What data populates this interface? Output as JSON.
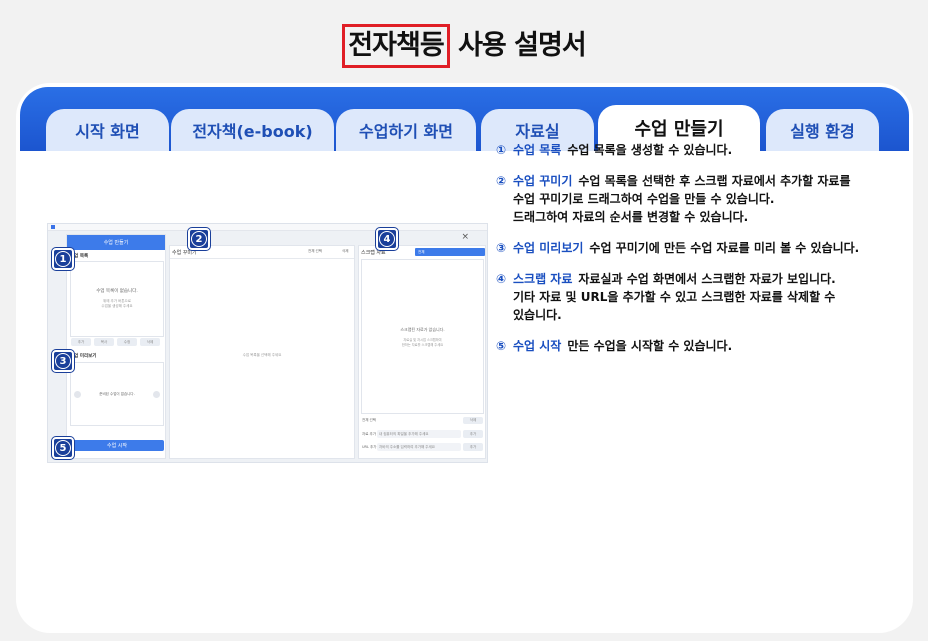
{
  "title": {
    "highlight": "전자책등",
    "rest": "사용 설명서"
  },
  "tabs": [
    {
      "label": "시작 화면"
    },
    {
      "label": "전자책(e-book)"
    },
    {
      "label": "수업하기 화면"
    },
    {
      "label": "자료실"
    },
    {
      "label": "수업 만들기"
    },
    {
      "label": "실행 환경"
    }
  ],
  "active_tab": "수업 만들기",
  "screenshot": {
    "window_title": "수업 만들기",
    "lesson_list": {
      "label": "수업 목록",
      "empty": "수업 목록이 없습니다.",
      "hint1": "위에 추가 버튼으로",
      "hint2": "수업을 생성해 주세요",
      "buttons": [
        "추가",
        "복사",
        "수정",
        "삭제"
      ]
    },
    "preview": {
      "label": "수업 미리보기",
      "empty": "준비된 수업이 없습니다."
    },
    "start_button": "수업 시작",
    "decorate": {
      "label": "수업 꾸미기",
      "select_all": "전체 선택",
      "delete": "삭제",
      "empty": "수업 목록을 선택해 주세요"
    },
    "scrap": {
      "label": "스크랩 자료",
      "filter": "전체",
      "empty": "스크랩된 자료가 없습니다.",
      "hint1": "자료실 및 자시업 스크랩하여",
      "hint2": "한하는 자료를 스크랩해 주세요",
      "select_all": "전체 선택",
      "delete": "삭제",
      "add_file_label": "자료 추가",
      "add_file_placeholder": "내 컴퓨터의 파일을 추가해 주세요",
      "add_url_label": "URL 추가",
      "add_url_placeholder": "자바의 주소를 입력하여 추가해 주세요",
      "add_button": "추가"
    },
    "close_icon": "×"
  },
  "badges": [
    "1",
    "2",
    "3",
    "4",
    "5"
  ],
  "descriptions": [
    {
      "num": "①",
      "head": "수업 목록",
      "lines": [
        "수업 목록을 생성할 수 있습니다."
      ]
    },
    {
      "num": "②",
      "head": "수업 꾸미기",
      "lines": [
        "수업 목록을 선택한 후 스크랩 자료에서 추가할 자료를",
        "수업 꾸미기로 드래그하여 수업을 만들 수 있습니다.",
        "드래그하여 자료의 순서를 변경할 수 있습니다."
      ]
    },
    {
      "num": "③",
      "head": "수업 미리보기",
      "lines": [
        "수업 꾸미기에 만든 수업 자료를 미리 볼 수 있습니다."
      ]
    },
    {
      "num": "④",
      "head": "스크랩 자료",
      "lines": [
        "자료실과 수업 화면에서 스크랩한 자료가 보입니다.",
        "기타 자료 및 URL을 추가할 수 있고 스크랩한 자료를 삭제할 수",
        "있습니다."
      ]
    },
    {
      "num": "⑤",
      "head": "수업 시작",
      "lines": [
        "만든 수업을 시작할 수 있습니다."
      ]
    }
  ],
  "colors": {
    "accent": "#1c55cf",
    "highlight_border": "#e01e26",
    "badge": "#1a3f9a"
  }
}
